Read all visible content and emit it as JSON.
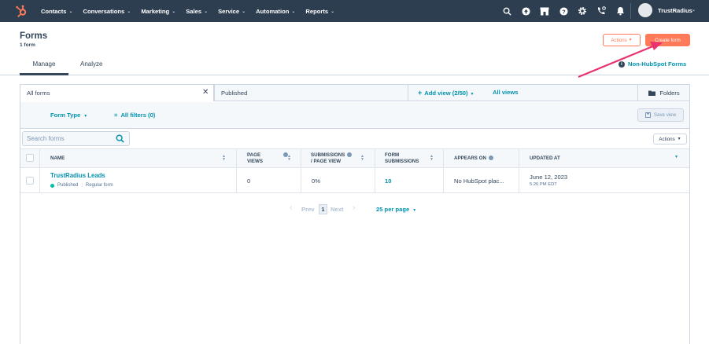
{
  "nav": {
    "menu": [
      "Contacts",
      "Conversations",
      "Marketing",
      "Sales",
      "Service",
      "Automation",
      "Reports"
    ],
    "account_name": "TrustRadius",
    "icons": [
      "search-icon",
      "upgrade-icon",
      "marketplace-icon",
      "help-icon",
      "settings-icon",
      "calling-icon",
      "notifications-icon"
    ],
    "bg_color": "#2d3e50",
    "logo_color": "#ff7a59"
  },
  "header": {
    "title": "Forms",
    "subtitle": "1 form",
    "actions_label": "Actions",
    "create_label": "Create form",
    "non_hubspot_label": "Non-HubSpot Forms"
  },
  "tabs": [
    {
      "label": "Manage",
      "active": true
    },
    {
      "label": "Analyze",
      "active": false
    }
  ],
  "views": {
    "all_forms": "All forms",
    "published": "Published",
    "add_view": "Add view (2/50)",
    "all_views": "All views",
    "folders": "Folders"
  },
  "filters": {
    "form_type": "Form Type",
    "all_filters": "All filters (0)",
    "save_view": "Save view"
  },
  "search": {
    "placeholder": "Search forms"
  },
  "table": {
    "actions_label": "Actions",
    "columns": {
      "name": "NAME",
      "page_views_1": "PAGE",
      "page_views_2": "VIEWS",
      "subs_per_view_1": "SUBMISSIONS",
      "subs_per_view_2": "/ PAGE VIEW",
      "form_subs_1": "FORM",
      "form_subs_2": "SUBMISSIONS",
      "appears_on": "APPEARS ON",
      "updated_at": "UPDATED AT"
    },
    "rows": [
      {
        "name": "TrustRadius Leads",
        "status": "Published",
        "type": "Regular form",
        "page_views": "0",
        "subs_per_view": "0%",
        "form_submissions": "10",
        "appears_on": "No HubSpot plac...",
        "updated_date": "June 12, 2023",
        "updated_time": "5:26 PM EDT"
      }
    ]
  },
  "pagination": {
    "prev": "Prev",
    "current": "1",
    "next": "Next",
    "per_page": "25 per page"
  },
  "accent_colors": {
    "orange": "#ff7a59",
    "teal": "#0091ae",
    "annotation_arrow": "#e8336f",
    "published_dot": "#00bda5"
  }
}
